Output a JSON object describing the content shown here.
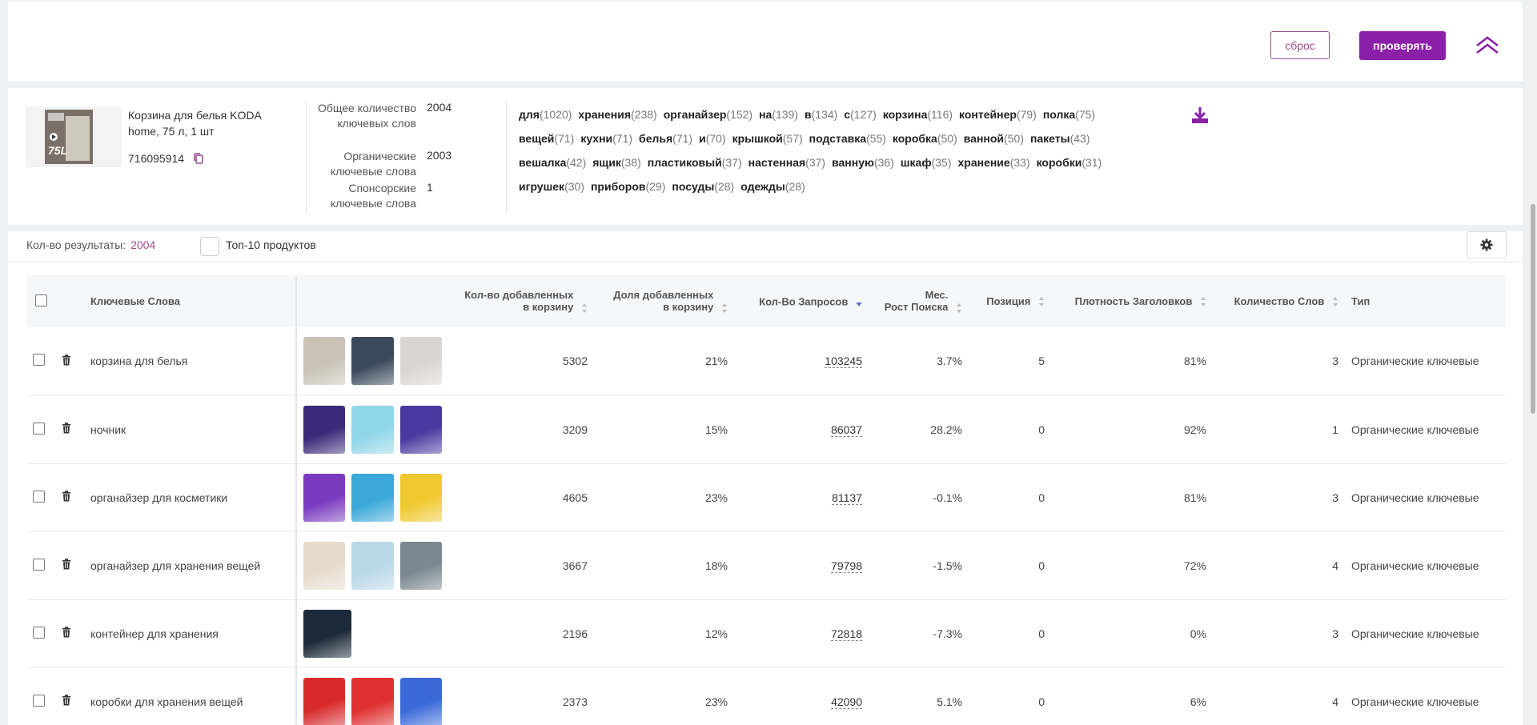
{
  "header": {
    "reset_label": "сброс",
    "check_label": "проверять"
  },
  "product": {
    "name": "Корзина для белья KODA home, 75 л, 1 шт",
    "sku": "716095914",
    "image_caption": "75L",
    "stats": [
      {
        "label": "Общее количество ключевых слов",
        "value": "2004"
      },
      {
        "label": "Органические ключевые слова",
        "value": "2003"
      },
      {
        "label": "Спонсорские ключевые слова",
        "value": "1"
      }
    ]
  },
  "word_cloud": [
    {
      "word": "для",
      "count": "(1020)"
    },
    {
      "word": "хранения",
      "count": "(238)"
    },
    {
      "word": "органайзер",
      "count": "(152)"
    },
    {
      "word": "на",
      "count": "(139)"
    },
    {
      "word": "в",
      "count": "(134)"
    },
    {
      "word": "с",
      "count": "(127)"
    },
    {
      "word": "корзина",
      "count": "(116)"
    },
    {
      "word": "контейнер",
      "count": "(79)"
    },
    {
      "word": "полка",
      "count": "(75)"
    },
    {
      "word": "вещей",
      "count": "(71)"
    },
    {
      "word": "кухни",
      "count": "(71)"
    },
    {
      "word": "белья",
      "count": "(71)"
    },
    {
      "word": "и",
      "count": "(70)"
    },
    {
      "word": "крышкой",
      "count": "(57)"
    },
    {
      "word": "подставка",
      "count": "(55)"
    },
    {
      "word": "коробка",
      "count": "(50)"
    },
    {
      "word": "ванной",
      "count": "(50)"
    },
    {
      "word": "пакеты",
      "count": "(43)"
    },
    {
      "word": "вешалка",
      "count": "(42)"
    },
    {
      "word": "ящик",
      "count": "(38)"
    },
    {
      "word": "пластиковый",
      "count": "(37)"
    },
    {
      "word": "настенная",
      "count": "(37)"
    },
    {
      "word": "ванную",
      "count": "(36)"
    },
    {
      "word": "шкаф",
      "count": "(35)"
    },
    {
      "word": "хранение",
      "count": "(33)"
    },
    {
      "word": "коробки",
      "count": "(31)"
    },
    {
      "word": "игрушек",
      "count": "(30)"
    },
    {
      "word": "приборов",
      "count": "(29)"
    },
    {
      "word": "посуды",
      "count": "(28)"
    },
    {
      "word": "одежды",
      "count": "(28)"
    }
  ],
  "results": {
    "count_label": "Кол-во результаты:",
    "count_value": "2004",
    "top10_label": "Топ-10 продуктов"
  },
  "table": {
    "columns": {
      "keywords": "Ключевые Слова",
      "cart_count_1": "Кол-во добавленных",
      "cart_count_2": "в корзину",
      "cart_share_1": "Доля добавленных",
      "cart_share_2": "в корзину",
      "requests": "Кол-Во Запросов",
      "growth_1": "Мес.",
      "growth_2": "Рост Поиска",
      "position": "Позиция",
      "title_density": "Плотность Заголовков",
      "word_count": "Количество Слов",
      "type": "Тип"
    },
    "rows": [
      {
        "keyword": "корзина для белья",
        "cart": "5302",
        "share": "21%",
        "requests": "103245",
        "growth": "3.7%",
        "position": "5",
        "density": "81%",
        "words": "3",
        "type": "Органические ключевые",
        "thumbs": [
          "#c9c2b5",
          "#3a4a5c",
          "#d8d6d2"
        ]
      },
      {
        "keyword": "ночник",
        "cart": "3209",
        "share": "15%",
        "requests": "86037",
        "growth": "28.2%",
        "position": "0",
        "density": "92%",
        "words": "1",
        "type": "Органические ключевые",
        "thumbs": [
          "#3b2a7a",
          "#8fd6e8",
          "#4a3aa0"
        ]
      },
      {
        "keyword": "органайзер для косметики",
        "cart": "4605",
        "share": "23%",
        "requests": "81137",
        "growth": "-0.1%",
        "position": "0",
        "density": "81%",
        "words": "3",
        "type": "Органические ключевые",
        "thumbs": [
          "#7a3ac0",
          "#3aa8d8",
          "#f0c830"
        ]
      },
      {
        "keyword": "органайзер для хранения вещей",
        "cart": "3667",
        "share": "18%",
        "requests": "79798",
        "growth": "-1.5%",
        "position": "0",
        "density": "72%",
        "words": "4",
        "type": "Органические ключевые",
        "thumbs": [
          "#e6dccb",
          "#b9d8e8",
          "#7a8890"
        ]
      },
      {
        "keyword": "контейнер для хранения",
        "cart": "2196",
        "share": "12%",
        "requests": "72818",
        "growth": "-7.3%",
        "position": "0",
        "density": "0%",
        "words": "3",
        "type": "Органические ключевые",
        "thumbs": [
          "#1d2a3a"
        ]
      },
      {
        "keyword": "коробки для хранения вещей",
        "cart": "2373",
        "share": "23%",
        "requests": "42090",
        "growth": "5.1%",
        "position": "0",
        "density": "6%",
        "words": "4",
        "type": "Органические ключевые",
        "thumbs": [
          "#d82a2a",
          "#e03030",
          "#3a6ad8"
        ]
      }
    ]
  }
}
